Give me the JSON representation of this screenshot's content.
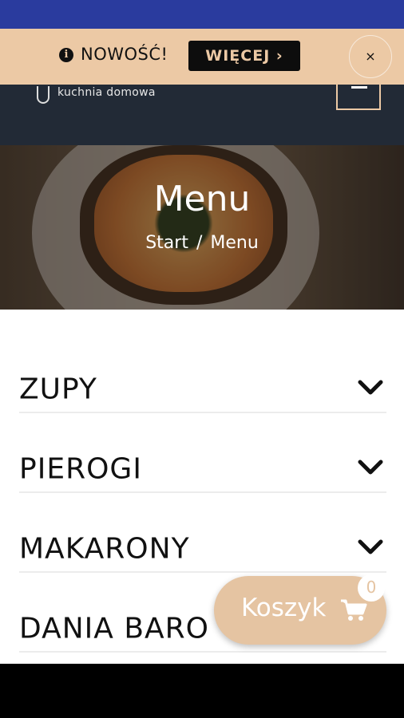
{
  "promo": {
    "info_icon": "info-icon",
    "text": "NOWOŚĆ!",
    "more_label": "WIĘCEJ ›",
    "close_label": "×"
  },
  "header": {
    "tagline": "kuchnia domowa",
    "menu_icon": "hamburger-icon"
  },
  "hero": {
    "title": "Menu",
    "breadcrumb": [
      "Start",
      "/",
      "Menu"
    ]
  },
  "menu": {
    "items": [
      {
        "label": "ZUPY"
      },
      {
        "label": "PIEROGI"
      },
      {
        "label": "MAKARONY"
      },
      {
        "label": "DANIA BARO"
      }
    ]
  },
  "cart": {
    "label": "Koszyk",
    "count": "0",
    "icon": "shopping-cart-icon"
  },
  "colors": {
    "accent": "#ecc9a5",
    "header_bg": "#222a36",
    "status_bar": "#2a3b9e",
    "cart_bg": "#e5c4a2"
  }
}
